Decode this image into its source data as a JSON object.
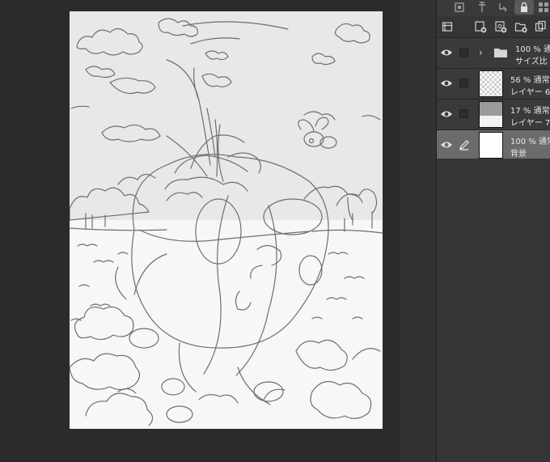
{
  "layers_panel": {
    "layers": [
      {
        "opacity": "100 %",
        "blend": "通常",
        "name": "サイズ比",
        "kind": "folder",
        "selected": false
      },
      {
        "opacity": "56 %",
        "blend": "通常",
        "name": "レイヤー 6",
        "kind": "raster",
        "selected": false
      },
      {
        "opacity": "17 %",
        "blend": "通常",
        "name": "レイヤー 7",
        "kind": "raster",
        "selected": false
      },
      {
        "opacity": "100 %",
        "blend": "通常",
        "name": "背景",
        "kind": "background",
        "selected": true
      }
    ]
  },
  "icons": {
    "top_tools": [
      "layer-property-icon",
      "transform-icon",
      "clip-icon",
      "lock-icon",
      "reference-icon"
    ],
    "toolbar": [
      "layer-list-icon",
      "new-raster-layer-icon",
      "new-vector-layer-icon",
      "new-folder-icon",
      "duplicate-layer-icon"
    ]
  },
  "colors": {
    "canvas_bg": "#2b2b2b",
    "panel_bg": "#353535",
    "selected_layer": "#6b6b6b",
    "sketch_line": "#6e6e6e"
  }
}
